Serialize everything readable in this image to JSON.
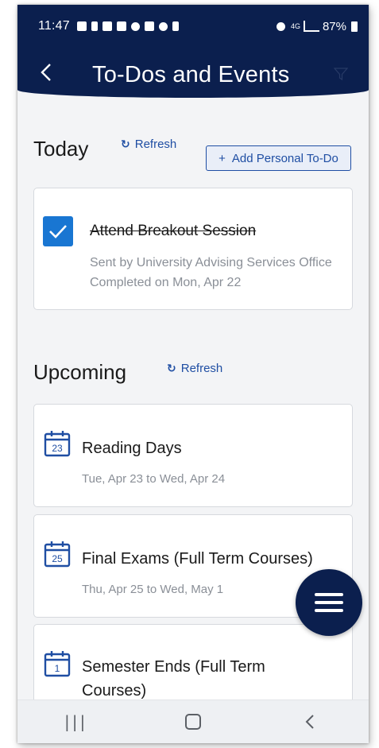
{
  "status_bar": {
    "time": "11:47",
    "network": "4G",
    "battery": "87%"
  },
  "header": {
    "title": "To-Dos and Events",
    "back_icon": "chevron-left-icon",
    "filter_icon": "filter-icon"
  },
  "today": {
    "title": "Today",
    "refresh_label": "Refresh",
    "add_button_label": "Add Personal To-Do",
    "add_icon": "+",
    "todos": [
      {
        "title": "Attend Breakout Session",
        "sent_by": "Sent by University Advising Services Office",
        "completed": "Completed on Mon, Apr 22",
        "checked": true
      }
    ]
  },
  "upcoming": {
    "title": "Upcoming",
    "refresh_label": "Refresh",
    "events": [
      {
        "day": "23",
        "title": "Reading Days",
        "dates": "Tue, Apr 23 to Wed, Apr 24"
      },
      {
        "day": "25",
        "title": "Final Exams (Full Term Courses)",
        "dates": "Thu, Apr 25 to Wed, May 1"
      },
      {
        "day": "1",
        "title_line1": "Semester Ends (Full Term",
        "title_line2": "Courses)"
      }
    ]
  },
  "colors": {
    "header_bg": "#0b1f4e",
    "accent_blue": "#1f4ea3",
    "checkbox_blue": "#1976d2",
    "card_border": "#d6d9de",
    "page_bg": "#f3f4f6"
  }
}
